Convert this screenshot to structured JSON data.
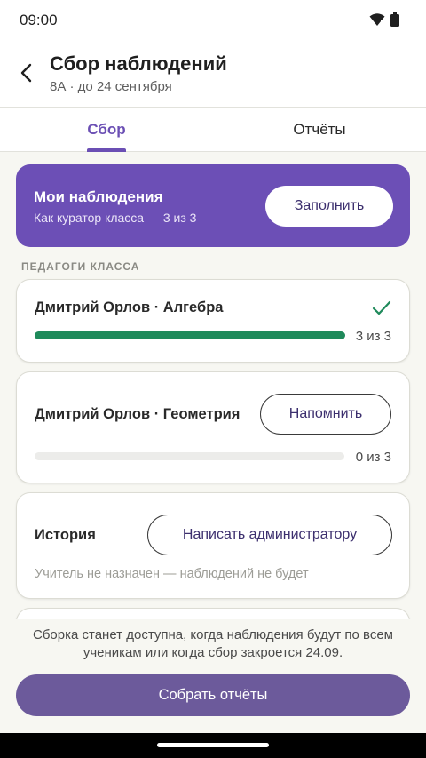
{
  "status": {
    "time": "09:00",
    "icons": [
      "wifi-icon",
      "battery-icon"
    ]
  },
  "header": {
    "title": "Сбор наблюдений",
    "subtitle": "8А · до 24 сентября"
  },
  "tabs": [
    {
      "label": "Сбор",
      "active": true
    },
    {
      "label": "Отчёты",
      "active": false
    }
  ],
  "my_observations": {
    "title": "Мои наблюдения",
    "subtitle": "Как куратор класса — 3 из 3",
    "button": "Заполнить"
  },
  "section_label": "ПЕДАГОГИ КЛАССА",
  "teachers": [
    {
      "name": "Дмитрий Орлов · Алгебра",
      "progress": 1.0,
      "count": "3 из 3",
      "icon": "check-icon"
    },
    {
      "name": "Дмитрий Орлов · Геометрия",
      "progress": 0.0,
      "count": "0 из 3",
      "button": "Напомнить"
    },
    {
      "name": "История",
      "button": "Написать администратору",
      "note": "Учитель не назначен — наблюдений не будет"
    }
  ],
  "footer": {
    "note": "Сборка станет доступна, когда наблюдения будут по всем ученикам или когда сбор закроется 24.09.",
    "button": "Собрать отчёты"
  },
  "colors": {
    "accent": "#6c4fb6",
    "progress_done": "#1f8a5b",
    "primary_button": "#6c5a9b"
  }
}
